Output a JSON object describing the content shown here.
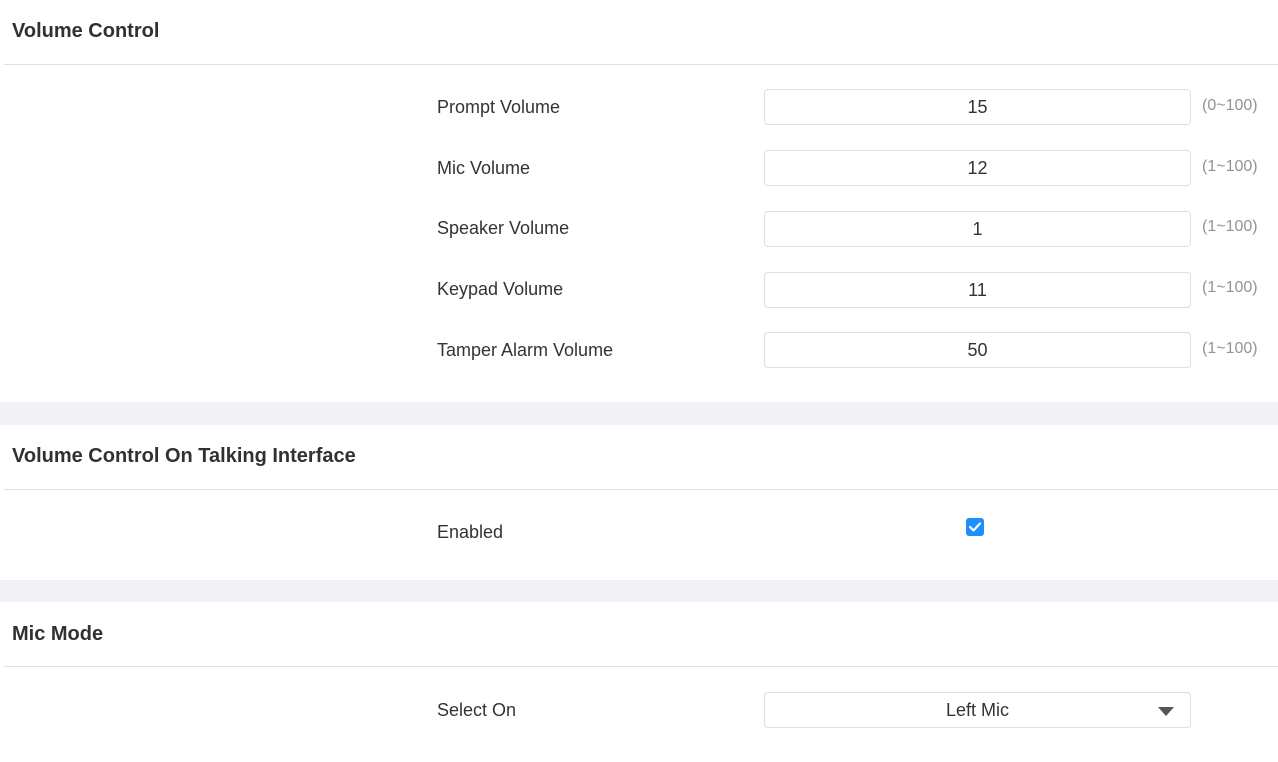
{
  "volume_control": {
    "title": "Volume Control",
    "rows": [
      {
        "label": "Prompt Volume",
        "value": "15",
        "range": "(0~100)"
      },
      {
        "label": "Mic Volume",
        "value": "12",
        "range": "(1~100)"
      },
      {
        "label": "Speaker Volume",
        "value": "1",
        "range": "(1~100)"
      },
      {
        "label": "Keypad Volume",
        "value": "11",
        "range": "(1~100)"
      },
      {
        "label": "Tamper Alarm Volume",
        "value": "50",
        "range": "(1~100)"
      }
    ]
  },
  "talking_interface": {
    "title": "Volume Control On Talking Interface",
    "enabled_label": "Enabled",
    "enabled": true
  },
  "mic_mode": {
    "title": "Mic Mode",
    "select_label": "Select On",
    "selected_value": "Left Mic"
  },
  "colors": {
    "accent": "#1e8fff",
    "section_gap": "#f0f2f5",
    "hint_text": "#909399",
    "border": "#dcdfe6"
  },
  "icons": {
    "checkbox_mark": "checkmark-icon",
    "select_arrow": "caret-down-icon"
  }
}
